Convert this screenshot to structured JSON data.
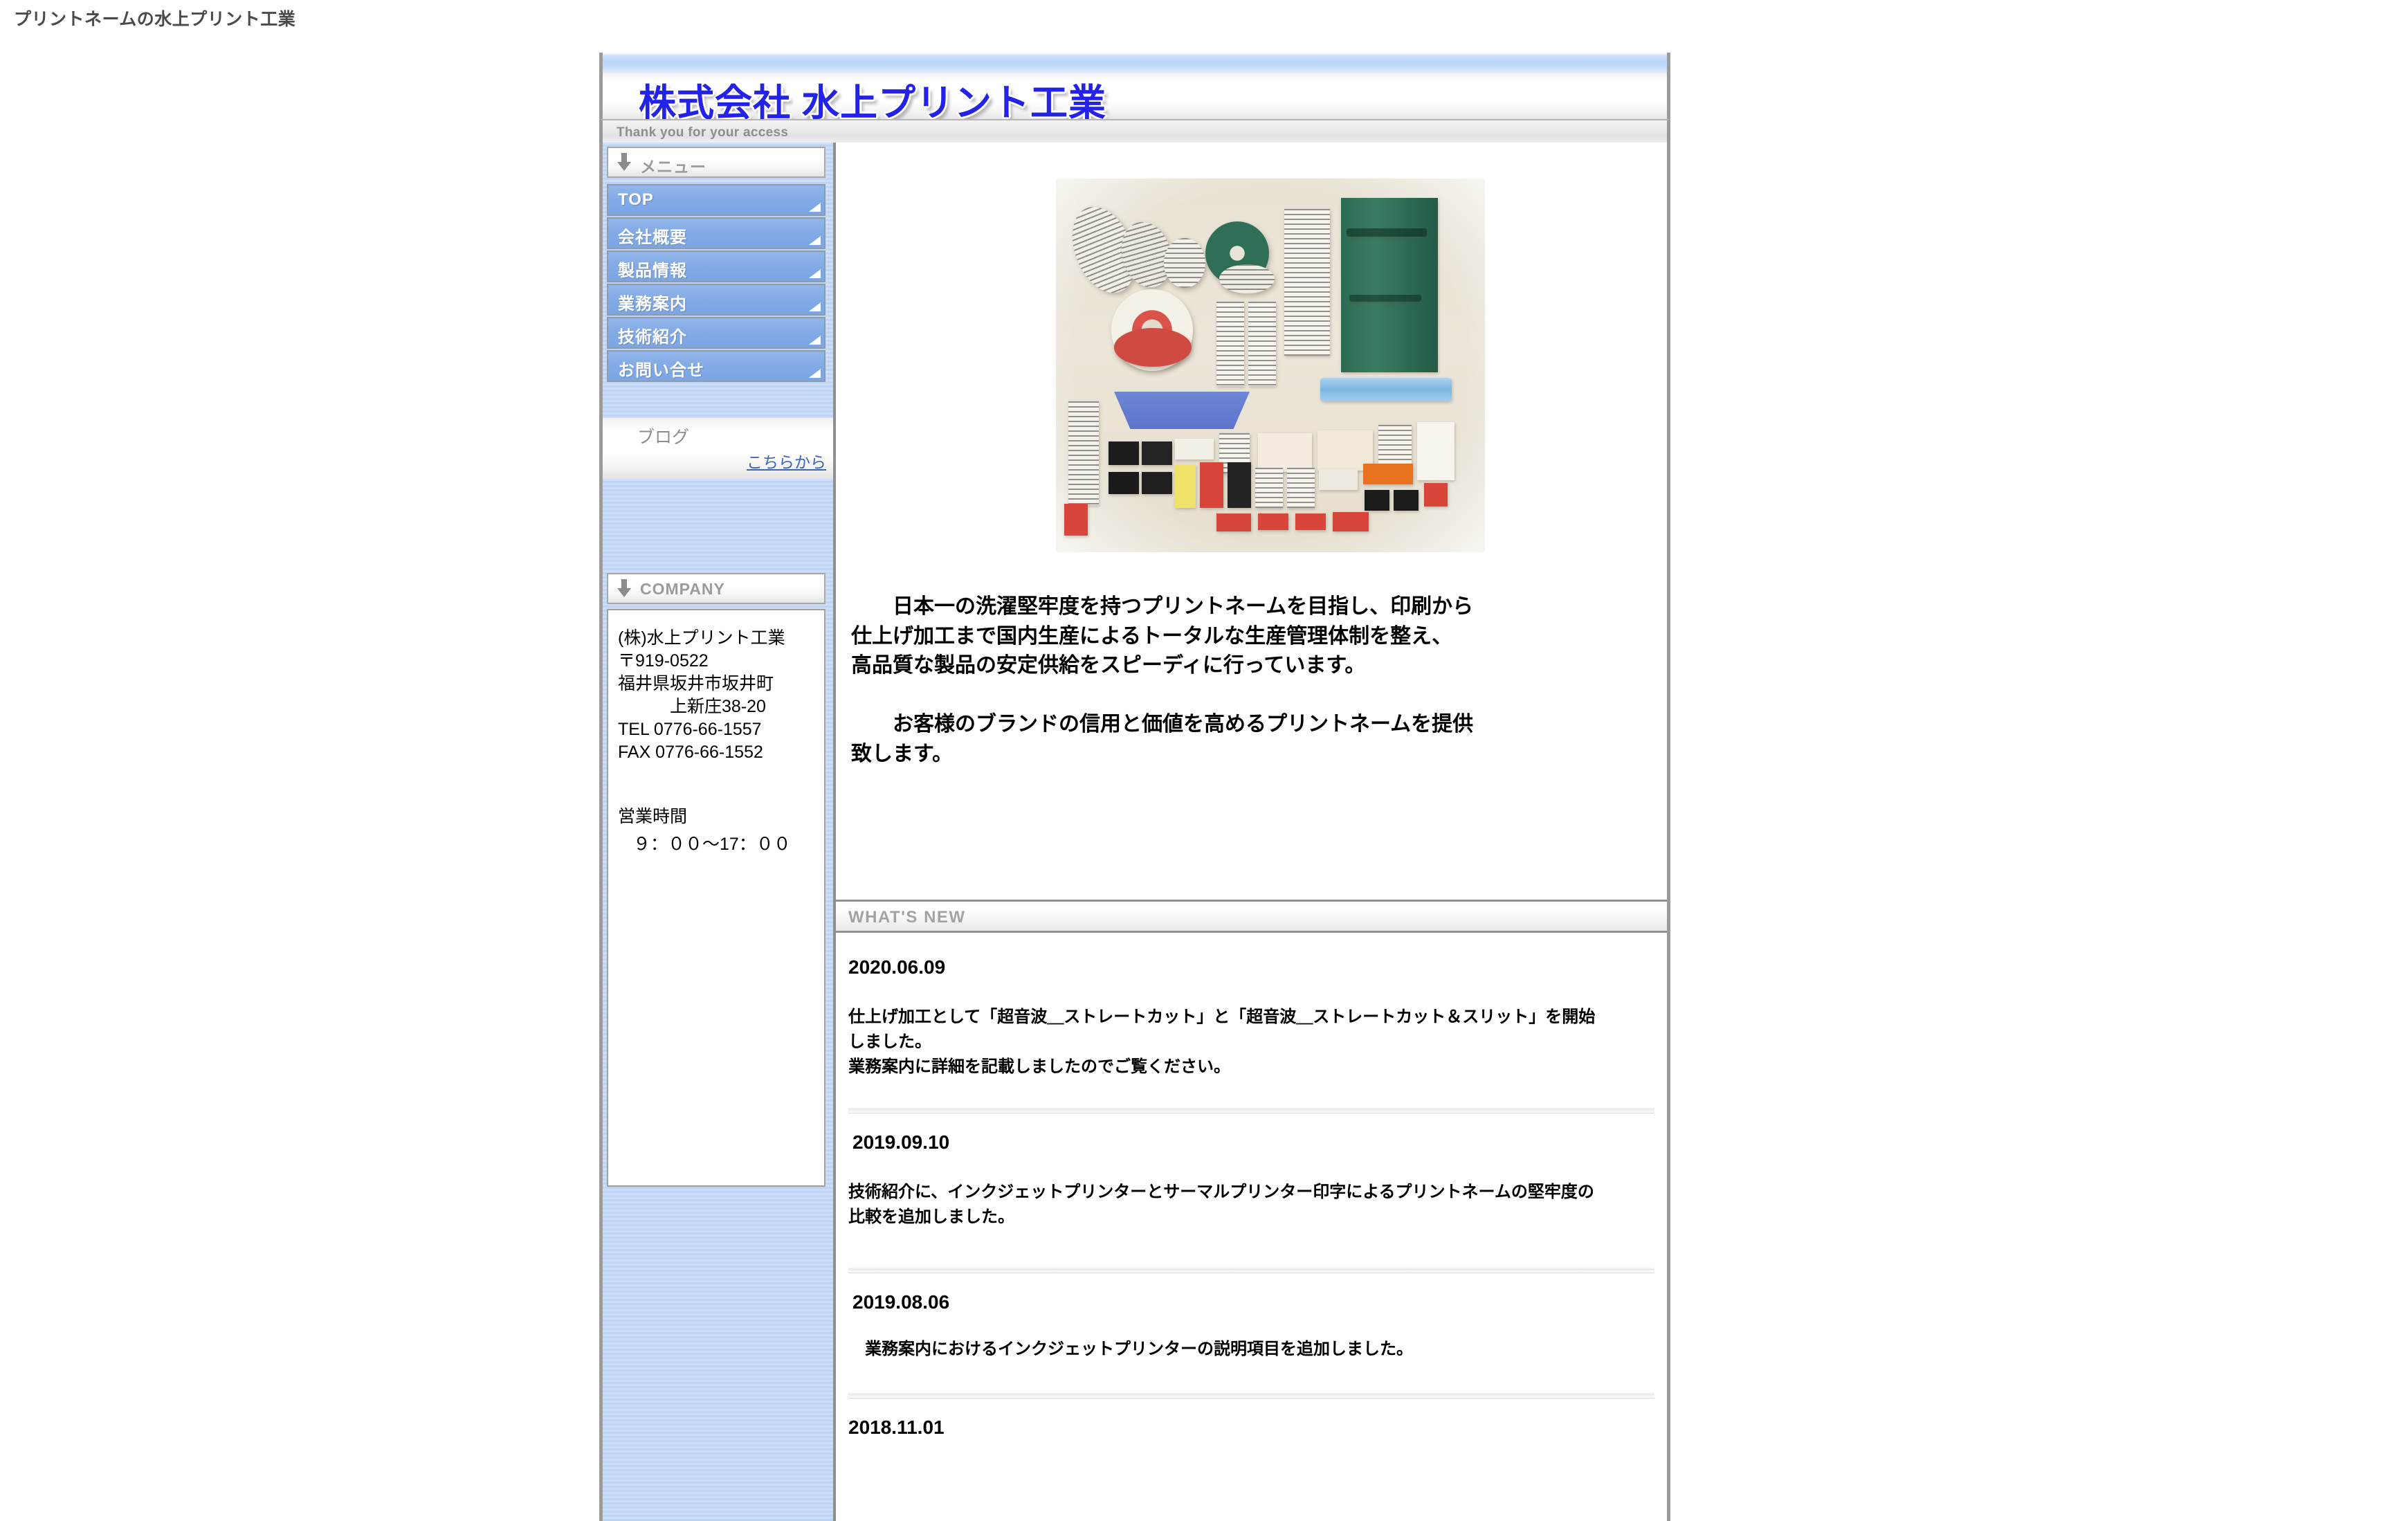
{
  "page": {
    "title_text": "プリントネームの水上プリント工業"
  },
  "header": {
    "logo_text": "株式会社 水上プリント工業",
    "tagline": "Thank you for your access"
  },
  "sidebar": {
    "menu_heading": "メニュー",
    "menu_items": [
      {
        "label": "TOP"
      },
      {
        "label": "会社概要"
      },
      {
        "label": "製品情報"
      },
      {
        "label": "業務案内"
      },
      {
        "label": "技術紹介"
      },
      {
        "label": "お問い合せ"
      }
    ],
    "blog": {
      "title": "ブログ",
      "link_label": "こちらから"
    },
    "company_heading": "COMPANY",
    "company": {
      "address_block": "(株)水上プリント工業\n〒919-0522\n福井県坂井市坂井町\n　　　上新庄38-20\nTEL 0776-66-1557\nFAX 0776-66-1552",
      "hours_label": "営業時間",
      "hours_value": "９：００〜17：００"
    }
  },
  "main": {
    "hero_image_alt": "プリントネーム（洗濯ネーム・ブランドラベル）の製品サンプル",
    "intro_text": "　　日本一の洗濯堅牢度を持つプリントネームを目指し、印刷から\n仕上げ加工まで国内生産によるトータルな生産管理体制を整え、\n高品質な製品の安定供給をスピーディに行っています。\n\n　　お客様のブランドの信用と価値を高めるプリントネームを提供\n致します。",
    "whats_new_heading": "WHAT'S NEW",
    "news": [
      {
        "date": "2020.06.09",
        "body": "仕上げ加工として「超音波＿ストレートカット」と「超音波＿ストレートカット＆スリット」を開始\nしました。\n業務案内に詳細を記載しましたのでご覧ください。"
      },
      {
        "date": "2019.09.10",
        "body": "技術紹介に、インクジェットプリンターとサーマルプリンター印字によるプリントネームの堅牢度の\n比較を追加しました。"
      },
      {
        "date": "2019.08.06",
        "body": "　業務案内におけるインクジェットプリンターの説明項目を追加しました。"
      },
      {
        "date": "2018.11.01",
        "body": ""
      }
    ]
  },
  "colors": {
    "logo_blue": "#2222e8",
    "menu_blue": "#83abe6",
    "sidebar_stripe": "#c3d8f7",
    "link_blue": "#3c63b5",
    "heading_gray": "#a3a3a3",
    "border_gray": "#9a9a9a"
  }
}
